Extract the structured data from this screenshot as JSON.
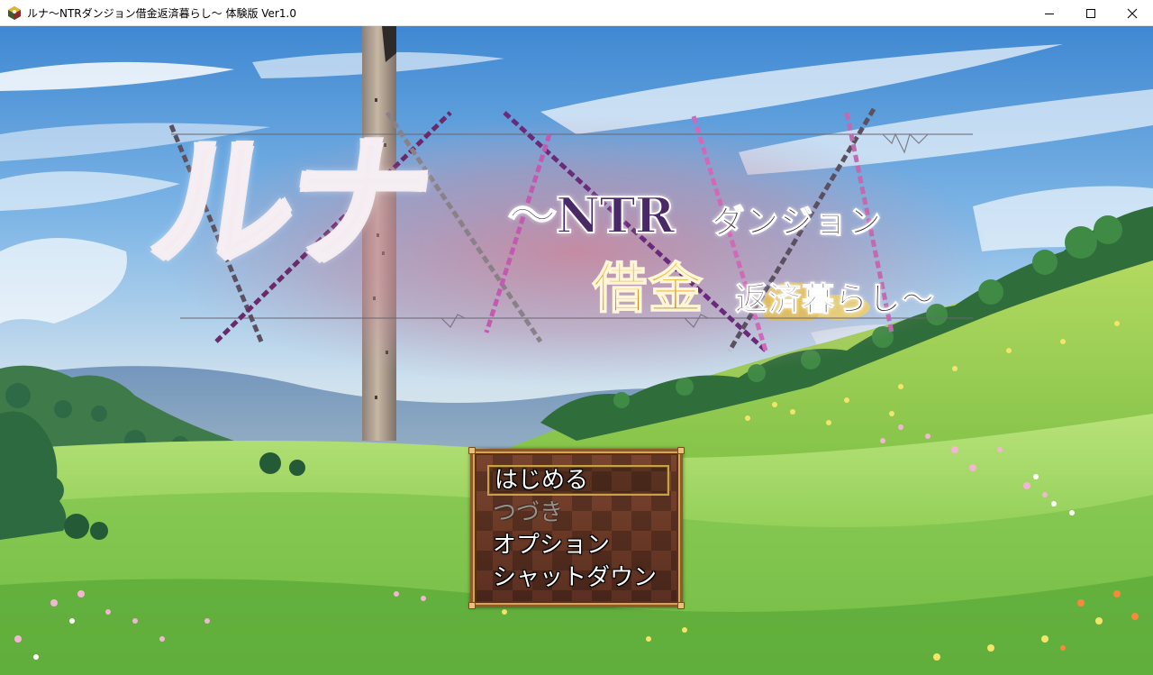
{
  "window": {
    "title": "ルナ～NTRダンジョン借金返済暮らし～ 体験版 Ver1.0",
    "icon": "rpg-maker-app-icon",
    "controls": [
      "minimize-icon",
      "maximize-icon",
      "close-icon"
    ]
  },
  "logo": {
    "main": "ルナ",
    "ntr": "～NTR",
    "dungeon": "ダンジョン",
    "debt": "借金",
    "sub": "返済暮らし～"
  },
  "menu": {
    "items": [
      {
        "label": "はじめる",
        "state": "selected"
      },
      {
        "label": "つづき",
        "state": "disabled"
      },
      {
        "label": "オプション",
        "state": "normal"
      },
      {
        "label": "シャットダウン",
        "state": "normal"
      }
    ]
  },
  "colors": {
    "menu_background": "#6a3c26",
    "menu_border": "#8e5a26",
    "cursor_border": "#c9a046",
    "logo_accent": "#c42c85",
    "gold": "#e0a41e"
  }
}
